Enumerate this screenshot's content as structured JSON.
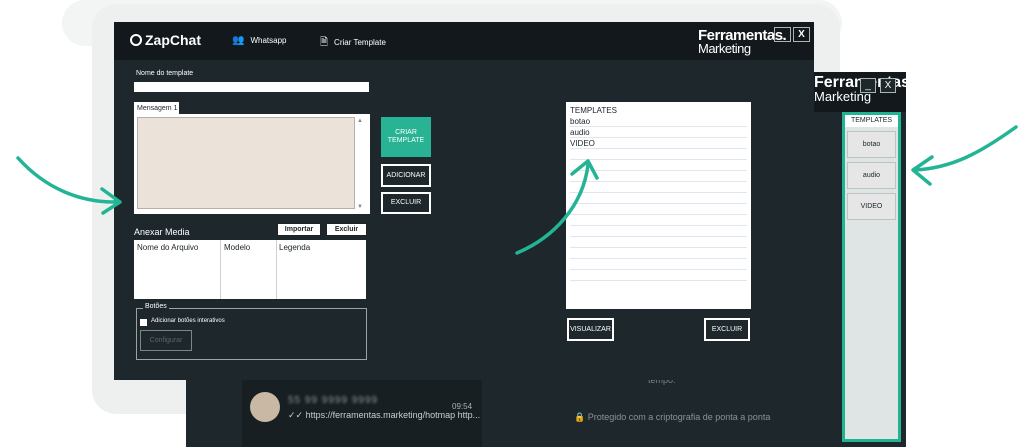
{
  "back_window": {
    "brand": "Ferramentas.",
    "brand_sub": "Marketing",
    "minimize": "_",
    "close": "X",
    "chat": {
      "name": "55 99 9999 9999",
      "time": "09:54",
      "message": "✓✓ https://ferramentas.marketing/hotmap http..."
    },
    "tempo_text": "tempo.",
    "protected_text": "🔒 Protegido com a criptografia de ponta a ponta"
  },
  "side_panel": {
    "title": "TEMPLATES",
    "items": [
      "botao",
      "audio",
      "VIDEO"
    ]
  },
  "main_window": {
    "logo": "ZapChat",
    "nav": [
      {
        "label": "Whatsapp",
        "icon": "users-add-icon"
      },
      {
        "label": "Criar Template",
        "icon": "document-icon"
      }
    ],
    "brand": "Ferramentas.",
    "brand_sub": "Marketing",
    "minimize": "_",
    "close": "X",
    "template_name_label": "Nome do template",
    "template_name_value": "",
    "message_tab": "Mensagem 1",
    "message_value": "",
    "buttons": {
      "criar_template": "CRIAR TEMPLATE",
      "adicionar": "ADICIONAR",
      "excluir": "EXCLUIR"
    },
    "media": {
      "title": "Anexar Media",
      "import_button": "Importar",
      "delete_button": "Excluir",
      "columns": [
        "Nome do Arquivo",
        "Modelo",
        "Legenda"
      ]
    },
    "botoes": {
      "group_label": "Botões",
      "checkbox_label": "Adicionar botões interativos",
      "checked": false,
      "configure_button": "Configurar"
    },
    "templates": {
      "title": "TEMPLATES",
      "items": [
        "botao",
        "audio",
        "VIDEO"
      ],
      "view_button": "VISUALIZAR",
      "delete_button": "EXCLUIR"
    }
  },
  "colors": {
    "window_bg": "#1d272c",
    "titlebar_bg": "#12181c",
    "accent": "#28b395"
  }
}
